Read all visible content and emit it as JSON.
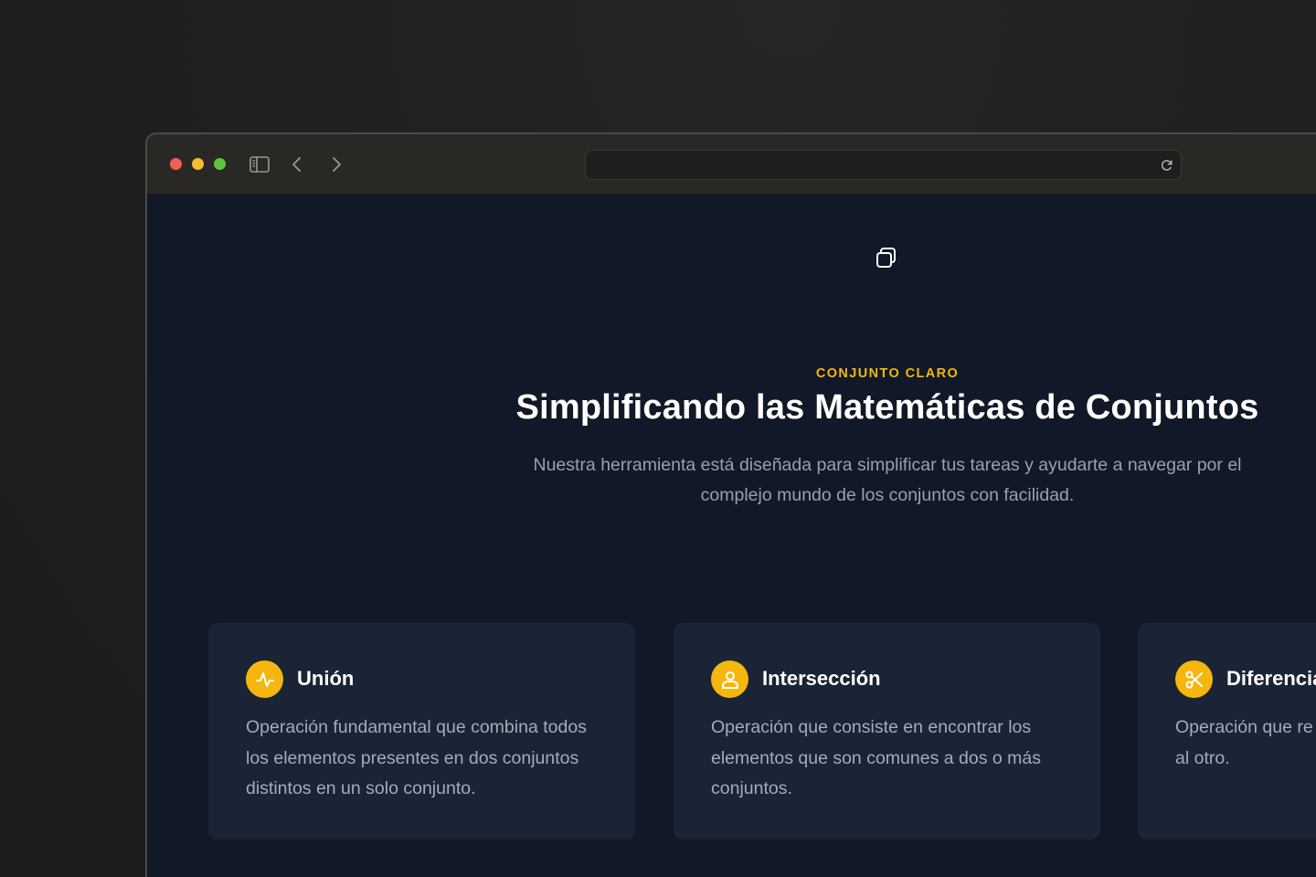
{
  "browser": {
    "url": "",
    "icons": {
      "sidebar": "sidebar-toggle-icon",
      "back": "chevron-left-icon",
      "forward": "chevron-right-icon",
      "reload": "reload-icon"
    },
    "traffic_lights": [
      "#ee5f57",
      "#f5bd2f",
      "#5fc33f"
    ]
  },
  "page": {
    "logo_icon": "overlapping-squares-icon",
    "eyebrow": "CONJUNTO CLARO",
    "title": "Simplificando las Matemáticas de Conjuntos",
    "subtitle": "Nuestra herramienta está diseñada para simplificar tus tareas y ayudarte a navegar por el complejo mundo de los conjuntos con facilidad.",
    "accent_color": "#f5b70f",
    "background_color": "#111827",
    "card_color": "#1b2435"
  },
  "features": [
    {
      "icon": "pulse-icon",
      "title": "Unión",
      "text": "Operación fundamental que combina todos los elementos presentes en dos conjuntos distintos en un solo conjunto."
    },
    {
      "icon": "user-icon",
      "title": "Intersección",
      "text": "Operación que consiste en encontrar los elementos que son comunes a dos o más conjuntos."
    },
    {
      "icon": "scissors-icon",
      "title": "Diferencia",
      "text": "Operación que re que pertenecen a pero no al otro."
    }
  ]
}
